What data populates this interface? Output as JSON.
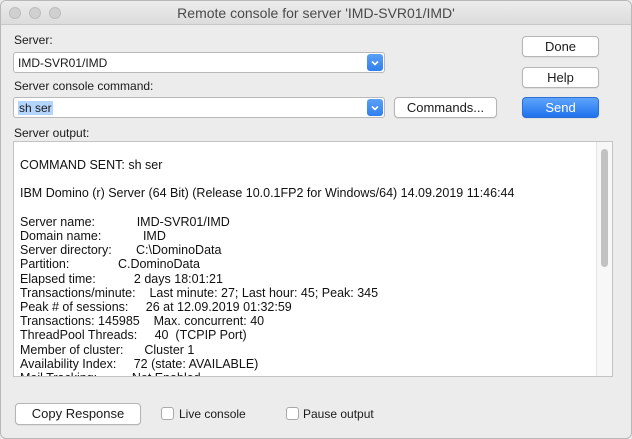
{
  "window": {
    "title": "Remote console for server 'IMD-SVR01/IMD'"
  },
  "server": {
    "label": "Server:",
    "value": "IMD-SVR01/IMD"
  },
  "command": {
    "label": "Server console command:",
    "value": "sh ser"
  },
  "buttons": {
    "done": "Done",
    "help": "Help",
    "commands": "Commands...",
    "send": "Send",
    "copy_response": "Copy Response"
  },
  "output": {
    "label": "Server output:",
    "lines": [
      "COMMAND SENT: sh ser",
      "",
      "IBM Domino (r) Server (64 Bit) (Release 10.0.1FP2 for Windows/64) 14.09.2019 11:46:44",
      "",
      "Server name:            IMD-SVR01/IMD",
      "Domain name:            IMD",
      "Server directory:       C:\\DominoData",
      "Partition:              C.DominoData",
      "Elapsed time:           2 days 18:01:21",
      "Transactions/minute:    Last minute: 27; Last hour: 45; Peak: 345",
      "Peak # of sessions:     26 at 12.09.2019 01:32:59",
      "Transactions: 145985    Max. concurrent: 40",
      "ThreadPool Threads:     40  (TCPIP Port)",
      "Member of cluster:      Cluster 1",
      "Availability Index:     72 (state: AVAILABLE)",
      "Mail Tracking:          Not Enabled"
    ]
  },
  "options": {
    "live_console": "Live console",
    "pause_output": "Pause output"
  }
}
